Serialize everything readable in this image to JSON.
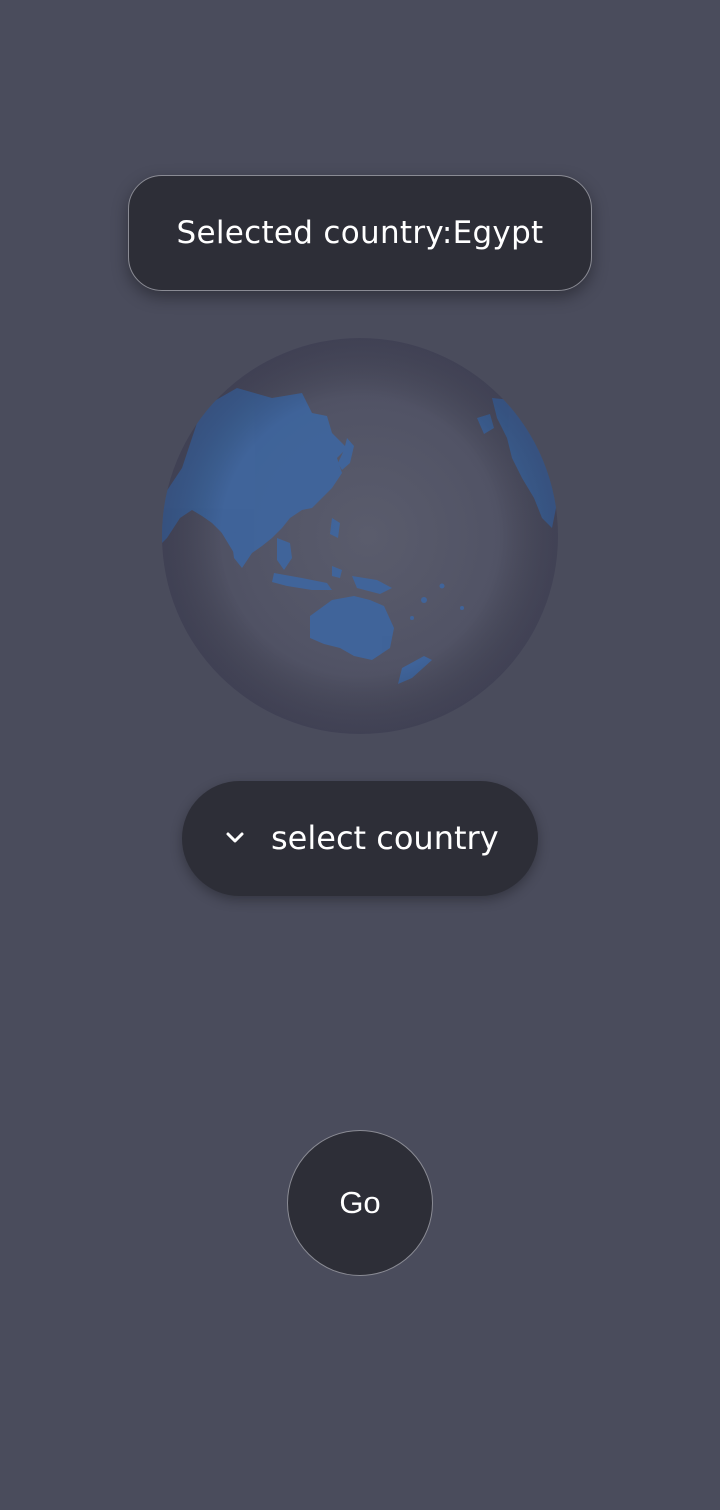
{
  "selected": {
    "prefix": "Selected country: ",
    "country": "Egypt"
  },
  "globe": {
    "icon": "globe-icon",
    "land_color": "#3f6aa8",
    "sphere_color": "#55576a"
  },
  "dropdown": {
    "label": "select country",
    "icon": "chevron-down-icon"
  },
  "go_button": {
    "label": "Go"
  },
  "colors": {
    "background": "#4a4c5c",
    "surface": "#2d2e37",
    "border": "#8a8b94",
    "text": "#ffffff"
  }
}
